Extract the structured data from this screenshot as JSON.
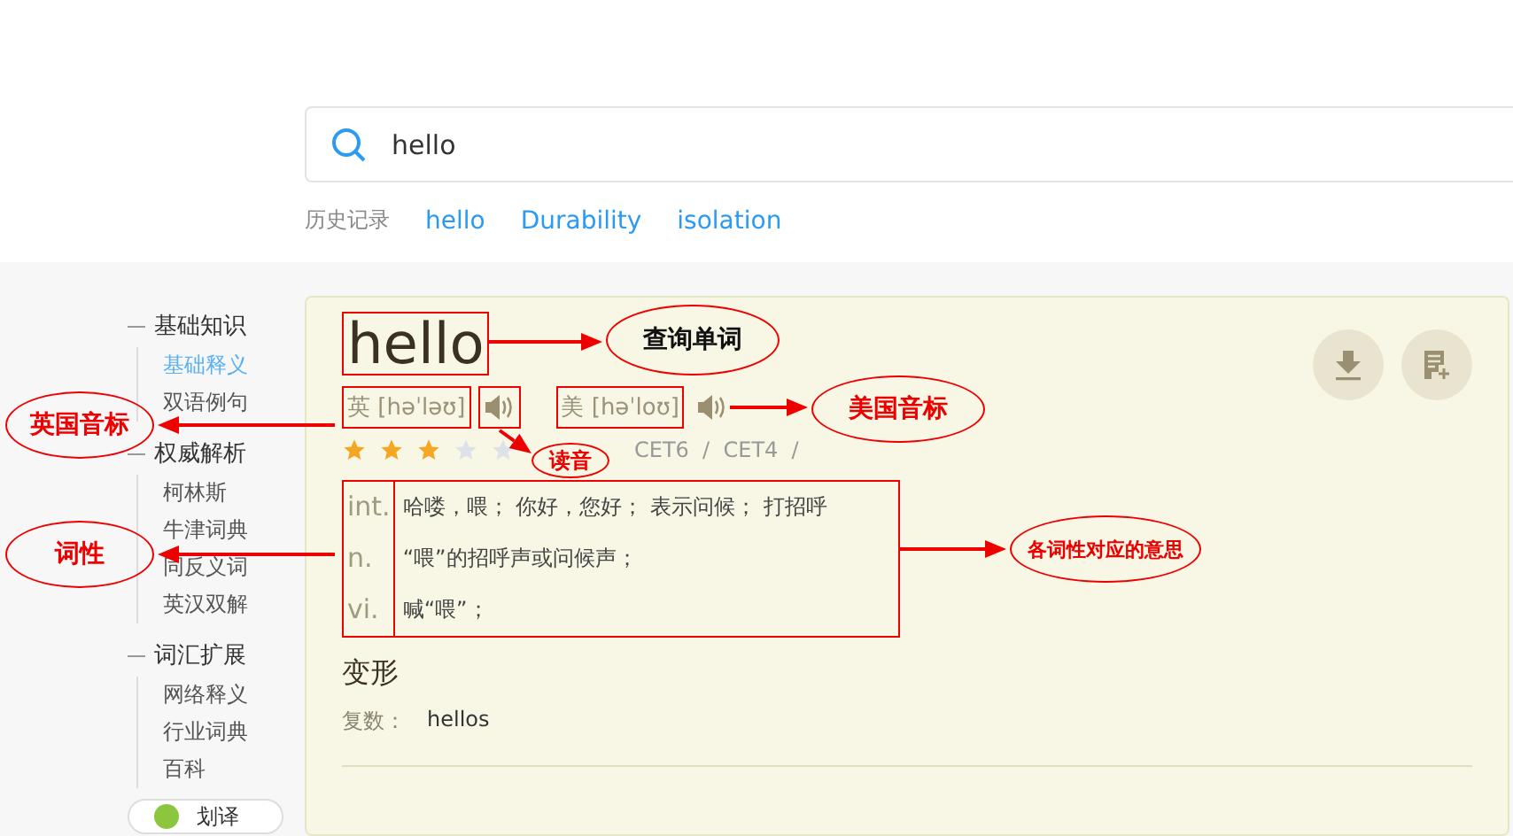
{
  "search": {
    "value": "hello"
  },
  "history": {
    "label": "历史记录",
    "items": [
      "hello",
      "Durability",
      "isolation"
    ]
  },
  "sidebar": [
    {
      "heading": "基础知识",
      "items": [
        {
          "label": "基础释义",
          "selected": true
        },
        {
          "label": "双语例句",
          "selected": false
        }
      ]
    },
    {
      "heading": "权威解析",
      "items": [
        {
          "label": "柯林斯",
          "selected": false
        },
        {
          "label": "牛津词典",
          "selected": false
        },
        {
          "label": "同反义词",
          "selected": false
        },
        {
          "label": "英汉双解",
          "selected": false
        }
      ]
    },
    {
      "heading": "词汇扩展",
      "items": [
        {
          "label": "网络释义",
          "selected": false
        },
        {
          "label": "行业词典",
          "selected": false
        },
        {
          "label": "百科",
          "selected": false
        }
      ]
    }
  ],
  "translate_button": {
    "label": "划译"
  },
  "entry": {
    "word": "hello",
    "pronunciations": [
      {
        "text": "英 [həˈləʊ]"
      },
      {
        "text": "美 [həˈloʊ]"
      }
    ],
    "stars": 3,
    "levels": "CET6  /  CET4  /",
    "senses": [
      {
        "pos": "int.",
        "meaning": "哈喽，喂； 你好，您好； 表示问候； 打招呼"
      },
      {
        "pos": "n.",
        "meaning": "“喂”的招呼声或问候声；"
      },
      {
        "pos": "vi.",
        "meaning": "喊“喂”；"
      }
    ],
    "forms_title": "变形",
    "forms": [
      {
        "label": "复数：",
        "value": "hellos"
      }
    ]
  },
  "annotations": [
    {
      "text": "查询单词"
    },
    {
      "text": "英国音标"
    },
    {
      "text": "美国音标"
    },
    {
      "text": "读音"
    },
    {
      "text": "词性"
    },
    {
      "text": "各词性对应的意思"
    }
  ]
}
